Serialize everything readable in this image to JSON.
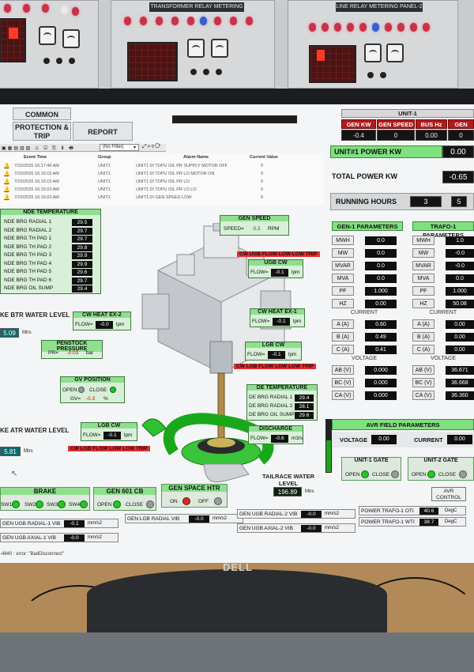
{
  "panel": {
    "left_label": "TRANSFORMER RELAY METERING PANEL-2",
    "right_label": "LINE RELAY METERING PANEL-2"
  },
  "nav": {
    "common": "COMMON",
    "protection": "PROTECTION & TRIP",
    "report": "REPORT"
  },
  "unit_header": {
    "title": "UNIT-1",
    "gen_kw_label": "GEN KW",
    "gen_kw_value": "-0.4",
    "gen_speed_label": "GEN SPEED",
    "gen_speed_value": "0",
    "bus_hz_label": "BUS Hz",
    "bus_hz_value": "0.00",
    "gen_label": "GEN",
    "gen_value": "0"
  },
  "alarm_toolbar": {
    "filter": "(No Filter)"
  },
  "alarm_table": {
    "headers": [
      "Event Time",
      "Group",
      "Alarm Name",
      "Current Value"
    ],
    "rows": [
      [
        "7/23/2025 16:17:46 AM",
        "UNIT1",
        "UNIT1 DI TOPU OIL PR SUPPLY MOTOR OFF",
        "0"
      ],
      [
        "7/23/2025 16:16:15 AM",
        "UNIT1",
        "UNIT1 DI TOPU OIL PR LO MOTOR ON",
        "0"
      ],
      [
        "7/23/2025 16:16:15 AM",
        "UNIT1",
        "UNIT1 DI TOPU OIL PR LO",
        "0"
      ],
      [
        "7/23/2025 16:16:03 AM",
        "UNIT1",
        "UNIT1 DI TOPU OIL PR LO LO",
        "0"
      ],
      [
        "7/23/2025 16:16:03 AM",
        "UNIT1",
        "UNIT1 DI GEN SPEED LOW",
        "0"
      ]
    ]
  },
  "nde_temp": {
    "title": "NDE TEMPERATURE",
    "rows": [
      {
        "label": "NDE BRG RADIAL 1",
        "value": "29.5"
      },
      {
        "label": "NDE BRG RADIAL 2",
        "value": "29.7"
      },
      {
        "label": "NDE BRG TH PAD 1",
        "value": "29.7"
      },
      {
        "label": "NDE BRG TH PAD 2",
        "value": "29.8"
      },
      {
        "label": "NDE BRG TH PAD 3",
        "value": "29.9"
      },
      {
        "label": "NDE BRG TH PAD 4",
        "value": "29.9"
      },
      {
        "label": "NDE BRG TH PAD 5",
        "value": "29.6"
      },
      {
        "label": "NDE BRG TH PAD 6",
        "value": "29.7"
      },
      {
        "label": "NDE BRG OIL SUMP",
        "value": "29.4"
      }
    ]
  },
  "btr_water": {
    "label": "KE BTR WATER LEVEL",
    "value": "5.09",
    "unit": "Mtrs"
  },
  "atr_water": {
    "label": "KE ATR WATER LEVEL",
    "value": "5.81",
    "unit": "Mtrs"
  },
  "gen_speed": {
    "title": "GEN SPEED",
    "prefix": "SPEED=",
    "value": "0.2",
    "unit": "RPM"
  },
  "ugb_cw": {
    "title": "UGB CW",
    "prefix": "FLOW=",
    "value": "-0.1",
    "unit": "lpm",
    "alarm": "CW UGB FLOW LOW LOW TRIP"
  },
  "cw_heat_ex2": {
    "title": "CW HEAT EX-2",
    "prefix": "FLOW=",
    "value": "-0.0",
    "unit": "lpm"
  },
  "cw_heat_ex1": {
    "title": "CW HEAT EX-1",
    "prefix": "FLOW=",
    "value": "-0.1",
    "unit": "lpm"
  },
  "penstock": {
    "title": "PENSTOCK PRESSURE",
    "prefix": "PR=",
    "value": "-0.03",
    "unit": "bar"
  },
  "lgb_cw": {
    "title": "LGB CW",
    "prefix": "FLOW=",
    "value": "-0.1",
    "unit": "lpm",
    "alarm": "CW LGB FLOW LOW LOW TRIP"
  },
  "gv_position": {
    "title": "GV POSITION",
    "open": "OPEN",
    "close": "CLOSE",
    "prefix": "GV=",
    "value": "-0.3",
    "unit": "%"
  },
  "de_temp": {
    "title": "DE TEMPERATURE",
    "rows": [
      {
        "label": "DE BRG RADIAL 1",
        "value": "29.4"
      },
      {
        "label": "DE BRG RADIAL 2",
        "value": "28.1"
      },
      {
        "label": "DE BRG OIL SUMP",
        "value": "29.6"
      }
    ]
  },
  "discharge": {
    "title": "DISCHARGE",
    "prefix": "FLOW=",
    "value": "-0.6",
    "unit": "m3/s"
  },
  "lgb_cw2": {
    "title": "LGB CW",
    "prefix": "FLOW=",
    "value": "-0.1",
    "unit": "lpm",
    "alarm": "CW LGB FLOW LOW LOW TRIP"
  },
  "tailrace": {
    "label": "TAILRACE WATER LEVEL",
    "value": "196.89",
    "unit": "Mtrs"
  },
  "brake": {
    "title": "BRAKE",
    "sw1": "SW1",
    "sw2": "SW2",
    "sw3": "SW3",
    "sw4": "SW4"
  },
  "gen_601_cb": {
    "title": "GEN 601 CB",
    "open": "OPEN",
    "close": "CLOSE"
  },
  "gen_space_htr": {
    "title": "GEN SPACE HTR",
    "on": "ON",
    "off": "OFF"
  },
  "vib": [
    {
      "label": "GEN UGB RADIAL-1 VIB",
      "value": "-0.1",
      "unit": "mm/s2"
    },
    {
      "label": "GEN LGB RADIAL VIB",
      "value": "-0.0",
      "unit": "mm/s2"
    },
    {
      "label": "GEN UGB RADIAL-2 VIB",
      "value": "-0.0",
      "unit": "mm/s2"
    },
    {
      "label": "GEN UGB AXIAL-1 VIB",
      "value": "-0.0",
      "unit": "mm/s2"
    },
    {
      "label": "GEN UGB AXIAL-2 VIB",
      "value": "-0.0",
      "unit": "mm/s2"
    }
  ],
  "power_trafo": [
    {
      "label": "POWER TRAFO-1 OTI",
      "value": "40.6",
      "unit": "DegC"
    },
    {
      "label": "POWER TRAFO-1 WTI",
      "value": "38.7",
      "unit": "DegC"
    }
  ],
  "status_line": "-4840 : error: \"BadDisconnect\"",
  "right": {
    "unit_power": {
      "label": "UNIT#1 POWER KW",
      "value": "0.00"
    },
    "total_power": {
      "label": "TOTAL POWER KW",
      "value": "-0.65"
    },
    "running_hours": {
      "label": "RUNNING HOURS",
      "value1": "3",
      "value2": "5"
    },
    "gen_params": {
      "title": "GEN-1 PARAMETERS",
      "rows": [
        {
          "label": "MWH",
          "value": "0.0"
        },
        {
          "label": "MW",
          "value": "0.0"
        },
        {
          "label": "MVAR",
          "value": "0.0"
        },
        {
          "label": "MVA",
          "value": "0.0"
        },
        {
          "label": "PF",
          "value": "1.000"
        },
        {
          "label": "HZ",
          "value": "0.00"
        }
      ],
      "current_title": "CURRENT",
      "current": [
        {
          "label": "A (A)",
          "value": "0.60"
        },
        {
          "label": "B (A)",
          "value": "0.49"
        },
        {
          "label": "C (A)",
          "value": "0.41"
        }
      ],
      "voltage_title": "VOLTAGE",
      "voltage": [
        {
          "label": "AB (V)",
          "value": "0.000"
        },
        {
          "label": "BC (V)",
          "value": "0.000"
        },
        {
          "label": "CA (V)",
          "value": "0.000"
        }
      ]
    },
    "trafo_params": {
      "title": "TRAFO-1 PARAMETERS",
      "rows": [
        {
          "label": "MWH",
          "value": "1.0"
        },
        {
          "label": "MW",
          "value": "-0.0"
        },
        {
          "label": "MVAR",
          "value": "-0.0"
        },
        {
          "label": "MVA",
          "value": "0.0"
        },
        {
          "label": "PF",
          "value": "1.000"
        },
        {
          "label": "HZ",
          "value": "50.08"
        }
      ],
      "current_title": "CURRENT",
      "current": [
        {
          "label": "A (A)",
          "value": "0.00"
        },
        {
          "label": "B (A)",
          "value": "0.00"
        },
        {
          "label": "C (A)",
          "value": "0.00"
        }
      ],
      "voltage_title": "VOLTAGE",
      "voltage": [
        {
          "label": "AB (V)",
          "value": "36.671"
        },
        {
          "label": "BC (V)",
          "value": "36.668"
        },
        {
          "label": "CA (V)",
          "value": "36.360"
        }
      ]
    },
    "avr": {
      "title": "AVR FIELD PARAMETERS",
      "voltage_label": "VOLTAGE",
      "voltage_value": "0.00",
      "current_label": "CURRENT",
      "current_value": "0.00"
    },
    "unit1_gate": {
      "title": "UNIT-1 GATE",
      "open": "OPEN",
      "close": "CLOSE"
    },
    "unit2_gate": {
      "title": "UNIT-2 GATE",
      "open": "OPEN",
      "close": "CLOSE"
    },
    "avr_control": "AVR CONTROL"
  },
  "brand": "DELL"
}
